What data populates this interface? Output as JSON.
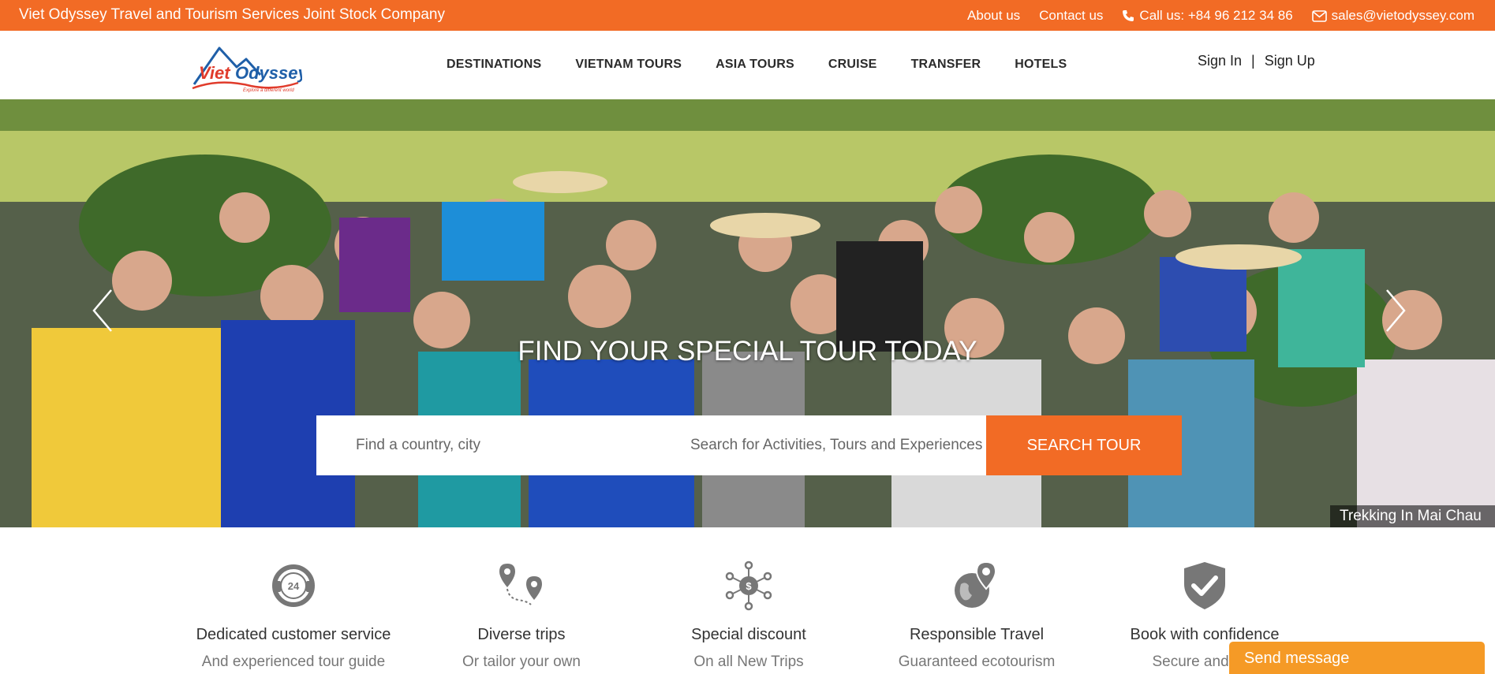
{
  "topbar": {
    "company": "Viet Odyssey Travel and Tourism Services Joint Stock Company",
    "about": "About us",
    "contact": "Contact us",
    "call": "Call us: +84 96 212 34 86",
    "email": "sales@vietodyssey.com"
  },
  "header": {
    "logo_text": "Viet Odyssey",
    "logo_tagline": "Explore a different world",
    "nav": [
      "DESTINATIONS",
      "VIETNAM TOURS",
      "ASIA TOURS",
      "CRUISE",
      "TRANSFER",
      "HOTELS"
    ],
    "sign_in": "Sign In",
    "separator": "|",
    "sign_up": "Sign Up"
  },
  "hero": {
    "headline": "FIND YOUR SPECIAL TOUR TODAY",
    "search_location_placeholder": "Find a country, city",
    "search_activity_placeholder": "Search for Activities, Tours and Experiences",
    "search_button": "SEARCH TOUR",
    "caption": "Trekking In Mai Chau"
  },
  "features": [
    {
      "icon": "24h-support-icon",
      "title": "Dedicated customer service",
      "subtitle": "And experienced tour guide"
    },
    {
      "icon": "route-pins-icon",
      "title": "Diverse trips",
      "subtitle": "Or tailor your own"
    },
    {
      "icon": "discount-network-icon",
      "title": "Special discount",
      "subtitle": "On all New Trips"
    },
    {
      "icon": "globe-pin-icon",
      "title": "Responsible Travel",
      "subtitle": "Guaranteed ecotourism"
    },
    {
      "icon": "shield-check-icon",
      "title": "Book with confidence",
      "subtitle": "Secure and eas"
    }
  ],
  "chat": {
    "label": "Send message"
  },
  "colors": {
    "accent": "#f26b25",
    "chat": "#f59a26"
  }
}
